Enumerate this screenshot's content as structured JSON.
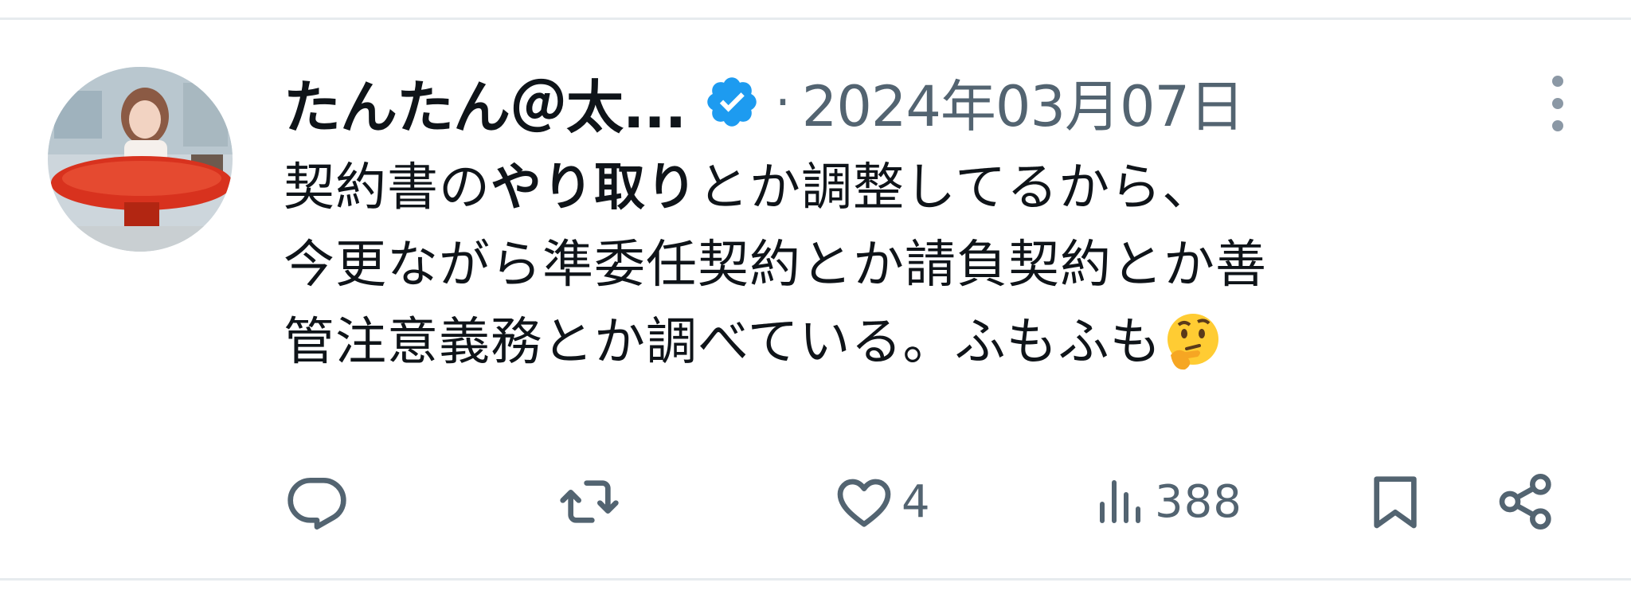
{
  "tweet": {
    "author_name": "たんたん＠太...",
    "separator": "·",
    "date": "2024年03月07日",
    "body": {
      "line1_pre": "契約書の",
      "line1_bold": "やり取り",
      "line1_post": "とか調整してるから、",
      "line2": "今更ながら準委任契約とか請負契約とか善",
      "line3": "管注意義務とか調べている。ふもふも"
    },
    "emoji": "thinking-face",
    "stats": {
      "likes": "4",
      "views": "388"
    }
  },
  "colors": {
    "text_primary": "#0f1419",
    "text_secondary": "#536471",
    "verified_blue": "#1d9bf0",
    "divider": "#e7ebee"
  },
  "icons": [
    "avatar",
    "verified-badge-icon",
    "more-icon",
    "reply-icon",
    "retweet-icon",
    "like-icon",
    "views-icon",
    "bookmark-icon",
    "share-icon"
  ]
}
